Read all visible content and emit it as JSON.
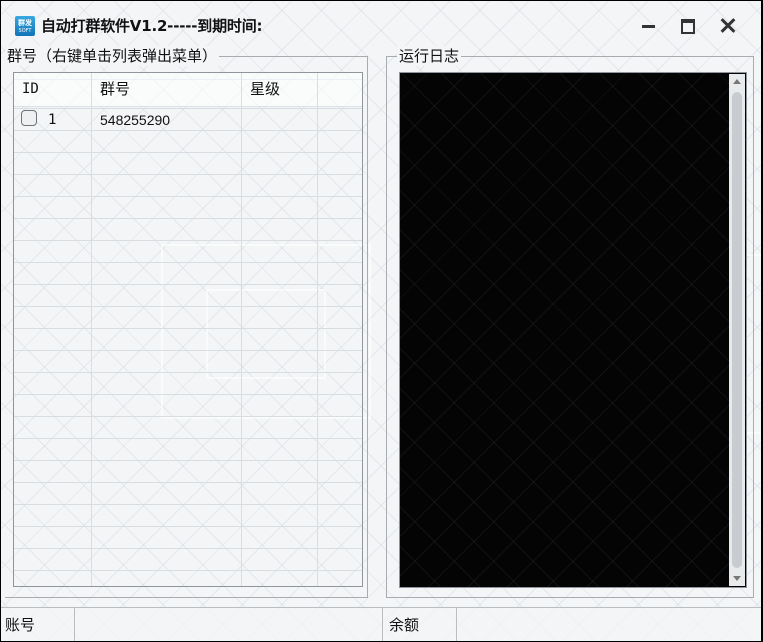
{
  "window": {
    "title": "自动打群软件V1.2-----到期时间:",
    "icon": "app-logo-icon"
  },
  "groups_panel": {
    "legend": "群号（右键单击列表弹出菜单）",
    "columns": [
      "ID",
      "群号",
      "星级"
    ],
    "rows": [
      {
        "id": "1",
        "group": "548255290",
        "star": "",
        "checked": false
      }
    ]
  },
  "log_panel": {
    "legend": "运行日志",
    "content": ""
  },
  "statusbar": {
    "account_label": "账号",
    "account_value": "",
    "balance_label": "余额",
    "balance_value": ""
  },
  "colors": {
    "log_background": "#040404",
    "icon_blue": "#1273b8"
  }
}
